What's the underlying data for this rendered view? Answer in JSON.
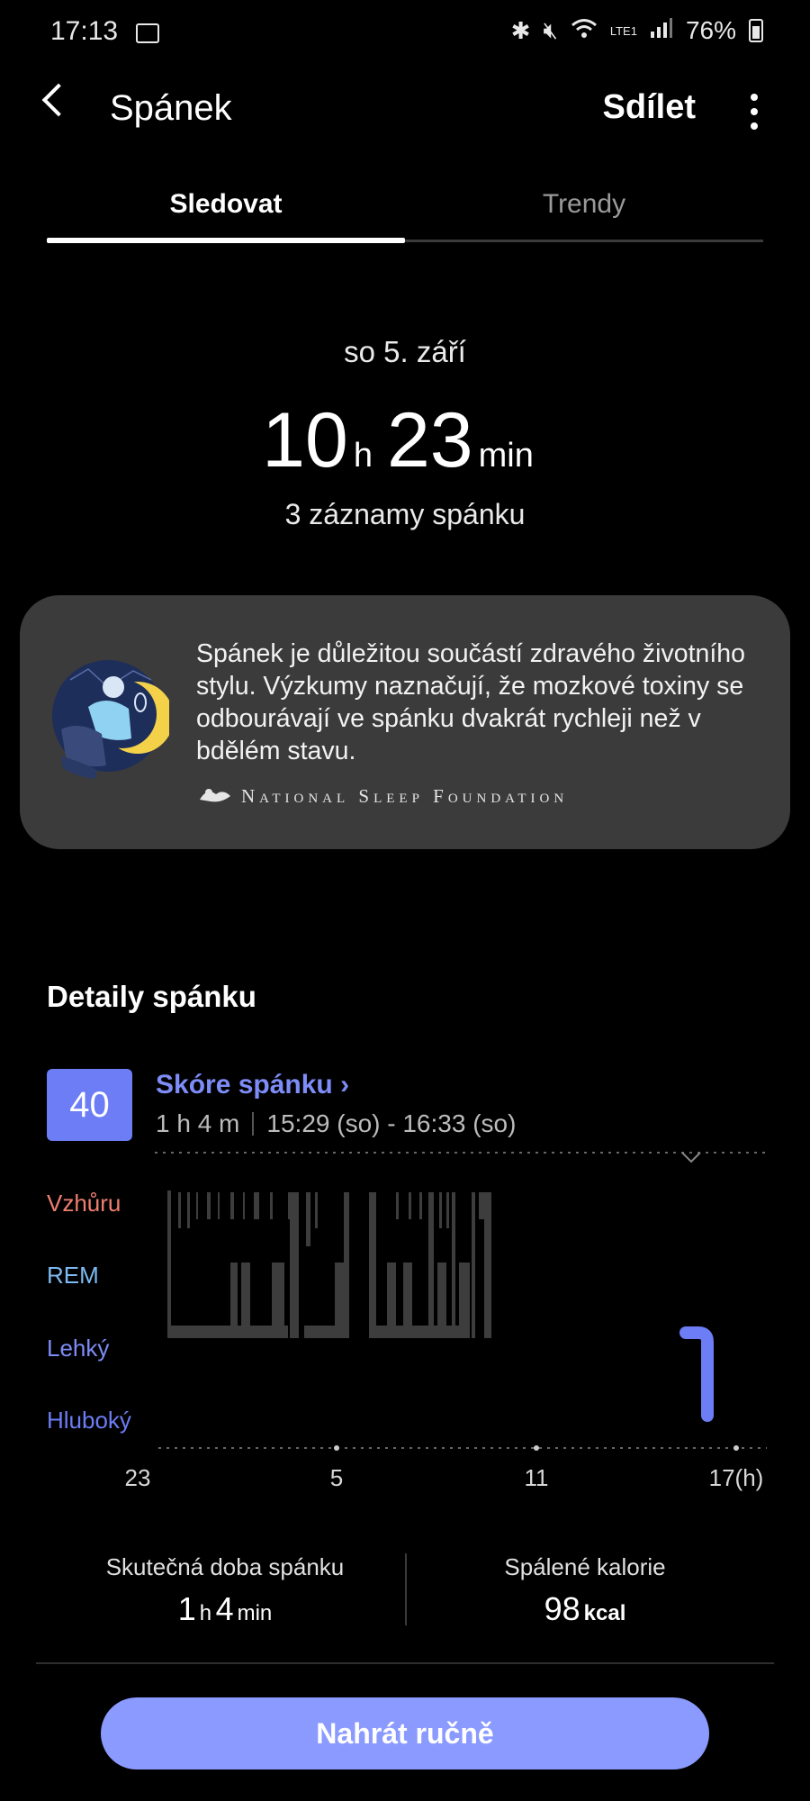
{
  "status_bar": {
    "time": "17:13",
    "image_icon": "image-icon",
    "bluetooth_icon": "bluetooth-icon",
    "mute_icon": "mute-icon",
    "wifi_icon": "wifi-icon",
    "network": "LTE1",
    "signal_icon": "signal-icon",
    "battery": "76%"
  },
  "header": {
    "back_icon": "back-arrow-icon",
    "title": "Spánek",
    "share_label": "Sdílet",
    "more_icon": "more-vert-icon"
  },
  "tabs": [
    {
      "label": "Sledovat",
      "active": true
    },
    {
      "label": "Trendy",
      "active": false
    }
  ],
  "summary": {
    "date": "so 5. září",
    "hours": "10",
    "hours_unit": "h",
    "minutes": "23",
    "minutes_unit": "min",
    "records": "3 záznamy spánku"
  },
  "info_card": {
    "illustration_icon": "sleep-person-moon-illustration",
    "text": "Spánek je důležitou součástí zdravého životního stylu. Výzkumy naznačují, že mozkové toxiny se odbourávají ve spánku dvakrát rychleji než v bdělém stavu.",
    "source_logo_icon": "nsf-logo-icon",
    "source": "National Sleep Foundation"
  },
  "details": {
    "title": "Detaily spánku",
    "score": "40",
    "score_label": "Skóre spánku",
    "score_chevron": "chevron-right-icon",
    "duration": "1 h 4 m",
    "range": "15:29 (so) - 16:33 (so)",
    "stages": [
      "Vzhůru",
      "REM",
      "Lehký",
      "Hluboký"
    ],
    "x_labels": [
      "23",
      "5",
      "11",
      "17(h)"
    ]
  },
  "stats": {
    "actual_label": "Skutečná doba spánku",
    "actual_h": "1",
    "actual_h_unit": "h",
    "actual_m": "4",
    "actual_m_unit": "min",
    "calories_label": "Spálené kalorie",
    "calories_value": "98",
    "calories_unit": "kcal"
  },
  "actions": {
    "upload_label": "Nahrát ručně"
  },
  "colors": {
    "accent": "#6c7df5",
    "button": "#8b9aff",
    "awake": "#f07e6f",
    "rem": "#7db9f2",
    "inactive_bars": "#3d3d3d"
  }
}
